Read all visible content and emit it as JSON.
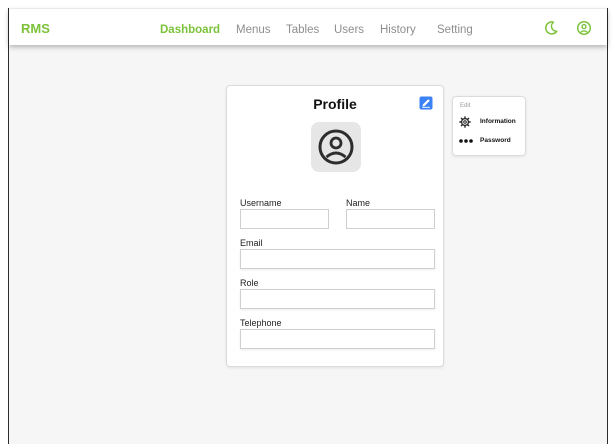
{
  "app": {
    "brand": "RMS"
  },
  "nav": {
    "items": [
      {
        "label": "Dashboard",
        "active": true
      },
      {
        "label": "Menus",
        "active": false
      },
      {
        "label": "Tables",
        "active": false
      },
      {
        "label": "Users",
        "active": false
      },
      {
        "label": "History",
        "active": false
      },
      {
        "label": "Setting",
        "active": false
      }
    ]
  },
  "header_icons": {
    "theme": "moon-icon",
    "account": "user-circle-icon"
  },
  "profile": {
    "title": "Profile",
    "edit_icon": "edit-icon",
    "avatar_icon": "user-circle-icon",
    "fields": {
      "username": {
        "label": "Username",
        "value": ""
      },
      "name": {
        "label": "Name",
        "value": ""
      },
      "email": {
        "label": "Email",
        "value": ""
      },
      "role": {
        "label": "Role",
        "value": ""
      },
      "telephone": {
        "label": "Telephone",
        "value": ""
      }
    }
  },
  "edit_menu": {
    "heading": "Edit",
    "items": [
      {
        "label": "Information",
        "icon": "gear-icon"
      },
      {
        "label": "Password",
        "icon": "password-dots-icon"
      }
    ]
  },
  "colors": {
    "accent": "#7cc23a",
    "nav_inactive": "#8e8e8e",
    "edit_icon": "#3b82f6"
  }
}
